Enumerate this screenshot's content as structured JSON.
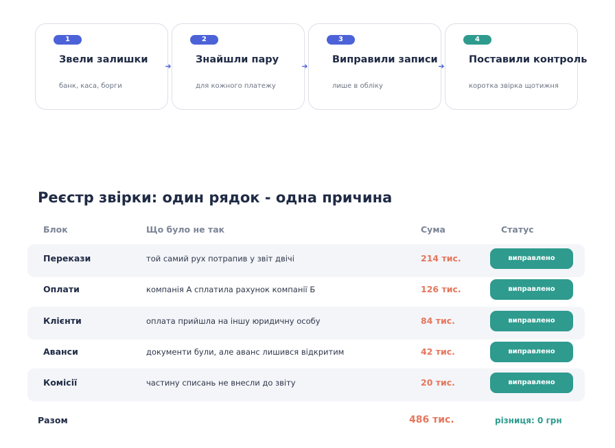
{
  "steps": [
    {
      "num": "1",
      "title": "Звели залишки",
      "subtitle": "банк, каса, борги",
      "color": "blue"
    },
    {
      "num": "2",
      "title": "Знайшли пару",
      "subtitle": "для кожного платежу",
      "color": "blue"
    },
    {
      "num": "3",
      "title": "Виправили записи",
      "subtitle": "лише в обліку",
      "color": "blue"
    },
    {
      "num": "4",
      "title": "Поставили контроль",
      "subtitle": "коротка звірка щотижня",
      "color": "teal"
    }
  ],
  "arrow_glyph": "➜",
  "register": {
    "title": "Реєстр звірки: один рядок - одна причина",
    "headers": {
      "block": "Блок",
      "issue": "Що було не так",
      "sum": "Сума",
      "status": "Статус"
    },
    "rows": [
      {
        "block": "Перекази",
        "issue": "той самий рух потрапив у звіт двічі",
        "sum": "214 тис.",
        "status": "виправлено"
      },
      {
        "block": "Оплати",
        "issue": "компанія А сплатила рахунок компанії Б",
        "sum": "126 тис.",
        "status": "виправлено"
      },
      {
        "block": "Клієнти",
        "issue": "оплата прийшла на іншу юридичну особу",
        "sum": "84 тис.",
        "status": "виправлено"
      },
      {
        "block": "Аванси",
        "issue": "документи були, але аванс лишився відкритим",
        "sum": "42 тис.",
        "status": "виправлено"
      },
      {
        "block": "Комісії",
        "issue": "частину списань не внесли до звіту",
        "sum": "20 тис.",
        "status": "виправлено"
      }
    ],
    "total": {
      "label": "Разом",
      "sum": "486 тис.",
      "difference": "різниця: 0 грн"
    }
  },
  "colors": {
    "accent_blue": "#4c62d8",
    "accent_teal": "#2e9b8e",
    "sum_orange": "#e4765c"
  }
}
